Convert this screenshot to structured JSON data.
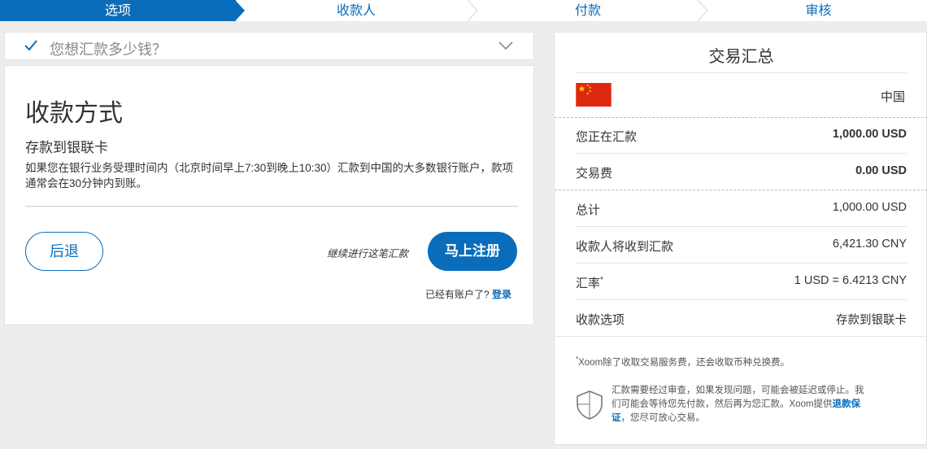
{
  "steps": [
    {
      "label": "选项",
      "active": true
    },
    {
      "label": "收款人",
      "active": false
    },
    {
      "label": "付款",
      "active": false
    },
    {
      "label": "审核",
      "active": false
    }
  ],
  "accordion": {
    "question": "您想汇款多少钱？"
  },
  "card": {
    "title": "收款方式",
    "method": "存款到银联卡",
    "description": "如果您在银行业务受理时间内（北京时间早上7:30到晚上10:30）汇款到中国的大多数银行账户，款项通常会在30分钟内到账。",
    "back_label": "后退",
    "continue_text": "继续进行这笔汇款",
    "register_label": "马上注册",
    "has_account_text": "已经有账户了?",
    "login_label": "登录"
  },
  "summary": {
    "title": "交易汇总",
    "country": "中国",
    "rows": [
      {
        "label": "您正在汇款",
        "value": "1,000.00 USD"
      },
      {
        "label": "交易费",
        "value": "0.00 USD"
      },
      {
        "label": "总计",
        "value": "1,000.00 USD"
      },
      {
        "label": "收款人将收到汇款",
        "value": "6,421.30 CNY"
      },
      {
        "label": "汇率",
        "sup": "*",
        "value": "1 USD = 6.4213 CNY"
      },
      {
        "label": "收款选项",
        "value": "存款到银联卡"
      }
    ],
    "footnote_mark": "*",
    "footnote": "Xoom除了收取交易服务费，还会收取币种兑换费。",
    "guarantee_text": "汇款需要经过审查，如果发现问题，可能会被延迟或停止。我们可能会等待您先付款，然后再为您汇款。Xoom提供",
    "guarantee_link": "退款保证",
    "guarantee_tail": "，您尽可放心交易。"
  },
  "colors": {
    "accent": "#0a6dbb",
    "flag_red": "#de2910",
    "flag_yellow": "#ffde00"
  }
}
